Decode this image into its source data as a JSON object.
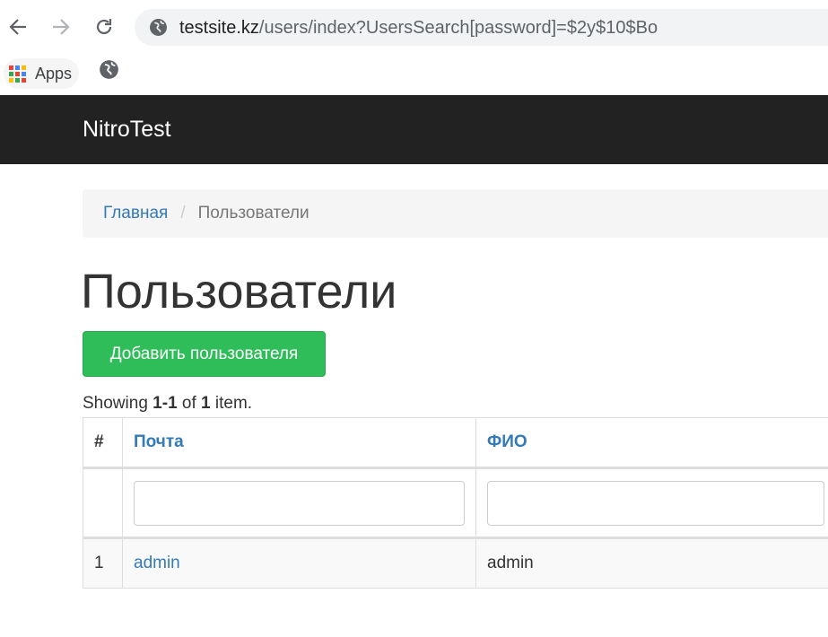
{
  "browser": {
    "url_host": "testsite.kz",
    "url_path": "/users/index?UsersSearch[password]=$2y$10$Bo",
    "bookmarks": {
      "apps_label": "Apps"
    }
  },
  "site": {
    "brand": "NitroTest"
  },
  "breadcrumb": {
    "home": "Главная",
    "separator": "/",
    "current": "Пользователи"
  },
  "page": {
    "title": "Пользователи",
    "add_button": "Добавить пользователя",
    "summary": {
      "prefix": "Showing ",
      "range": "1-1",
      "middle": " of ",
      "total": "1",
      "suffix": " item."
    }
  },
  "table": {
    "headers": {
      "num": "#",
      "email": "Почта",
      "name": "ФИО"
    },
    "filters": {
      "email_value": "",
      "name_value": ""
    },
    "rows": [
      {
        "num": "1",
        "email": "admin",
        "name": "admin"
      }
    ]
  },
  "colors": {
    "navbar": "#222222",
    "link": "#337ab7",
    "success": "#2ebd59"
  }
}
